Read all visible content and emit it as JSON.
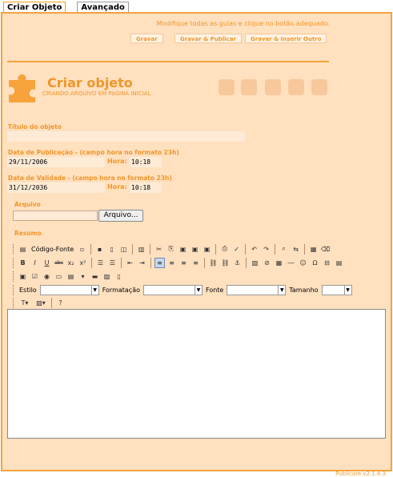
{
  "tabs": [
    {
      "label": "Criar Objeto"
    },
    {
      "label": "Avançado"
    }
  ],
  "hint": "Modifique todas as guias e clique no botão adequado.",
  "actions": {
    "save": "Gravar",
    "save_publish": "Gravar & Publicar",
    "save_insert": "Gravar & Inserir Outro"
  },
  "header": {
    "title": "Criar objeto",
    "subtitle": "CRIANDO ARQUIVO EM PáGINA INICIAL"
  },
  "form": {
    "title_label": "Título do objeto",
    "title_value": "",
    "pub_label": "Data de Publicação - (campo hora no formato 23h)",
    "pub_date": "29/11/2006",
    "pub_hour_label": "Hora:",
    "pub_hour": "10:18",
    "val_label": "Data de Validade - (campo hora no formato 23h)",
    "val_date": "31/12/2036",
    "val_hour_label": "Hora:",
    "val_hour": "10:18",
    "file_label": "Arquivo",
    "file_button": "Arquivo...",
    "summary_label": "Resumo"
  },
  "editor": {
    "source_label": "Código-Fonte",
    "style_label": "Estilo",
    "format_label": "Formatação",
    "font_label": "Fonte",
    "size_label": "Tamanho",
    "content": ""
  },
  "footer": "Publicare v2.1.4.3"
}
